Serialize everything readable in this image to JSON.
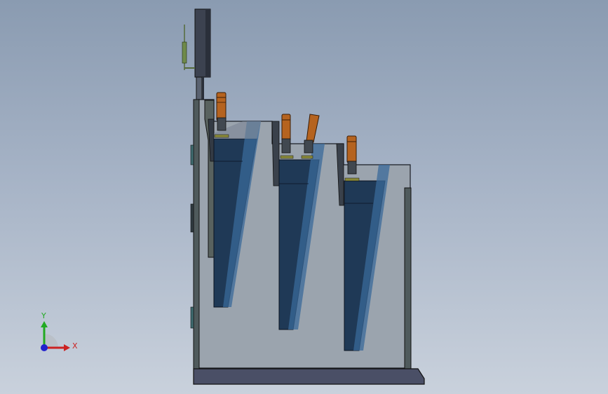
{
  "scene": {
    "background_top": "#8a9bb1",
    "background_bottom": "#c9d1dc",
    "housing_color": "#9aa3ae",
    "sink_fill": "#1f3956",
    "sink_highlight": "#3a6a9a",
    "base_color": "#4a4f66",
    "heater_color": "#b5631f",
    "icons": [
      "wash-tank-assembly",
      "coordinate-triad-icon"
    ]
  },
  "triad": {
    "y_label": "Y",
    "x_label": "X",
    "y_color": "#22aa22",
    "x_color": "#cc2222",
    "z_color": "#2222cc"
  }
}
